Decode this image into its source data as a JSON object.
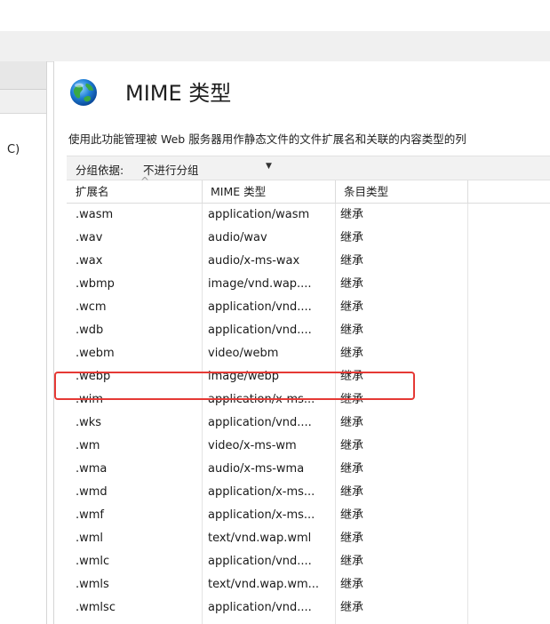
{
  "left_pane": {
    "partial_text": "C)"
  },
  "main": {
    "title": "MIME 类型",
    "description": "使用此功能管理被 Web 服务器用作静态文件的文件扩展名和关联的内容类型的列",
    "group_by": {
      "label": "分组依据:",
      "value": "不进行分组"
    },
    "columns": [
      "扩展名",
      "MIME 类型",
      "条目类型"
    ],
    "rows": [
      {
        "ext": ".wasm",
        "mime": "application/wasm",
        "type": "继承"
      },
      {
        "ext": ".wav",
        "mime": "audio/wav",
        "type": "继承"
      },
      {
        "ext": ".wax",
        "mime": "audio/x-ms-wax",
        "type": "继承"
      },
      {
        "ext": ".wbmp",
        "mime": "image/vnd.wap....",
        "type": "继承"
      },
      {
        "ext": ".wcm",
        "mime": "application/vnd....",
        "type": "继承"
      },
      {
        "ext": ".wdb",
        "mime": "application/vnd....",
        "type": "继承"
      },
      {
        "ext": ".webm",
        "mime": "video/webm",
        "type": "继承"
      },
      {
        "ext": ".webp",
        "mime": "image/webp",
        "type": "继承"
      },
      {
        "ext": ".wim",
        "mime": "application/x-ms...",
        "type": "继承"
      },
      {
        "ext": ".wks",
        "mime": "application/vnd....",
        "type": "继承"
      },
      {
        "ext": ".wm",
        "mime": "video/x-ms-wm",
        "type": "继承"
      },
      {
        "ext": ".wma",
        "mime": "audio/x-ms-wma",
        "type": "继承"
      },
      {
        "ext": ".wmd",
        "mime": "application/x-ms...",
        "type": "继承"
      },
      {
        "ext": ".wmf",
        "mime": "application/x-ms...",
        "type": "继承"
      },
      {
        "ext": ".wml",
        "mime": "text/vnd.wap.wml",
        "type": "继承"
      },
      {
        "ext": ".wmlc",
        "mime": "application/vnd....",
        "type": "继承"
      },
      {
        "ext": ".wmls",
        "mime": "text/vnd.wap.wm...",
        "type": "继承"
      },
      {
        "ext": ".wmlsc",
        "mime": "application/vnd....",
        "type": "继承"
      }
    ]
  },
  "colors": {
    "highlight_border": "#e53935"
  }
}
